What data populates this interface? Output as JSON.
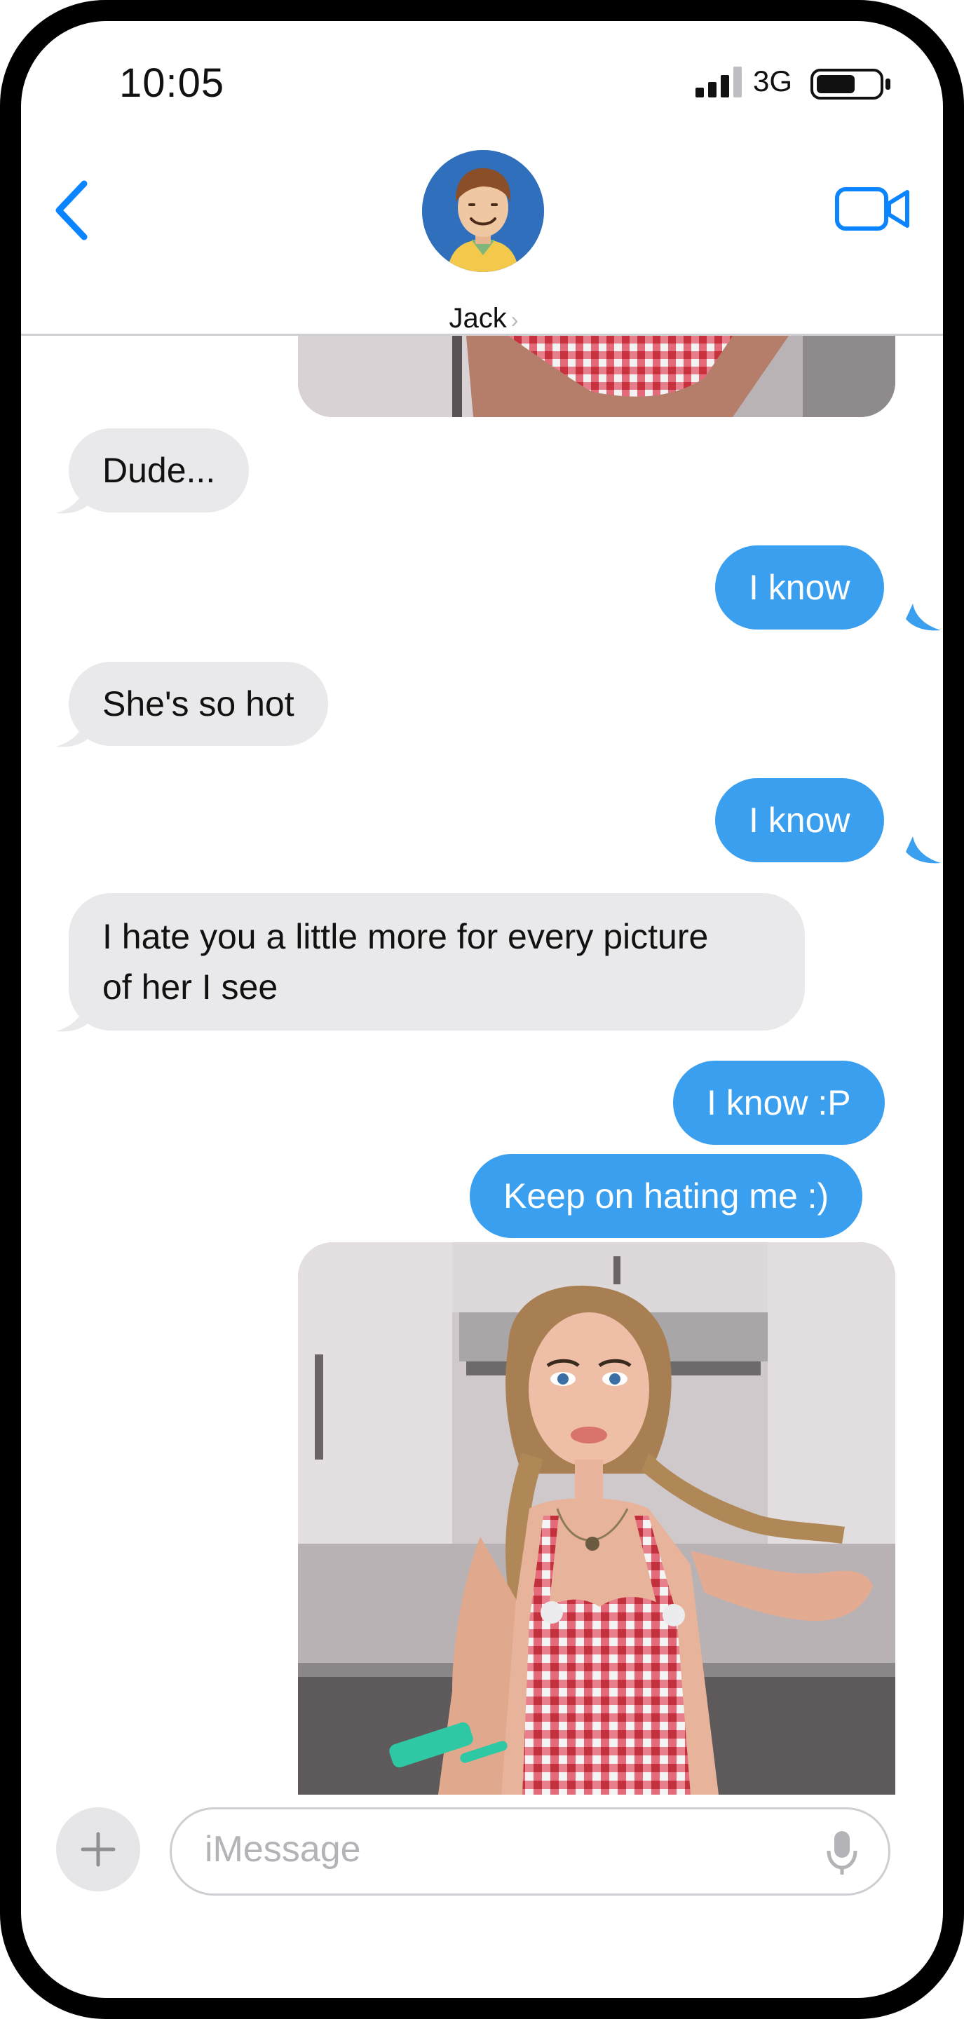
{
  "status_bar": {
    "time": "10:05",
    "network": "3G"
  },
  "header": {
    "contact_name": "Jack",
    "chevron": "›"
  },
  "messages": [
    {
      "from": "them",
      "text": "Dude..."
    },
    {
      "from": "me",
      "text": "I know"
    },
    {
      "from": "them",
      "text": "She's so hot"
    },
    {
      "from": "me",
      "text": "I know"
    },
    {
      "from": "them",
      "text_line1": "I hate you a little more for every picture",
      "text_line2": "of her I see"
    },
    {
      "from": "me",
      "text": "I know :P"
    },
    {
      "from": "me",
      "text": "Keep on hating me :)"
    }
  ],
  "input": {
    "placeholder": "iMessage"
  },
  "colors": {
    "accent": "#0a84ff",
    "outgoing_bubble": "#3b9ff0",
    "incoming_bubble": "#e9e9eb"
  },
  "icons": [
    "signal-bars-icon",
    "battery-icon",
    "back-chevron-icon",
    "video-camera-icon",
    "contact-avatar",
    "plus-icon",
    "microphone-icon"
  ]
}
